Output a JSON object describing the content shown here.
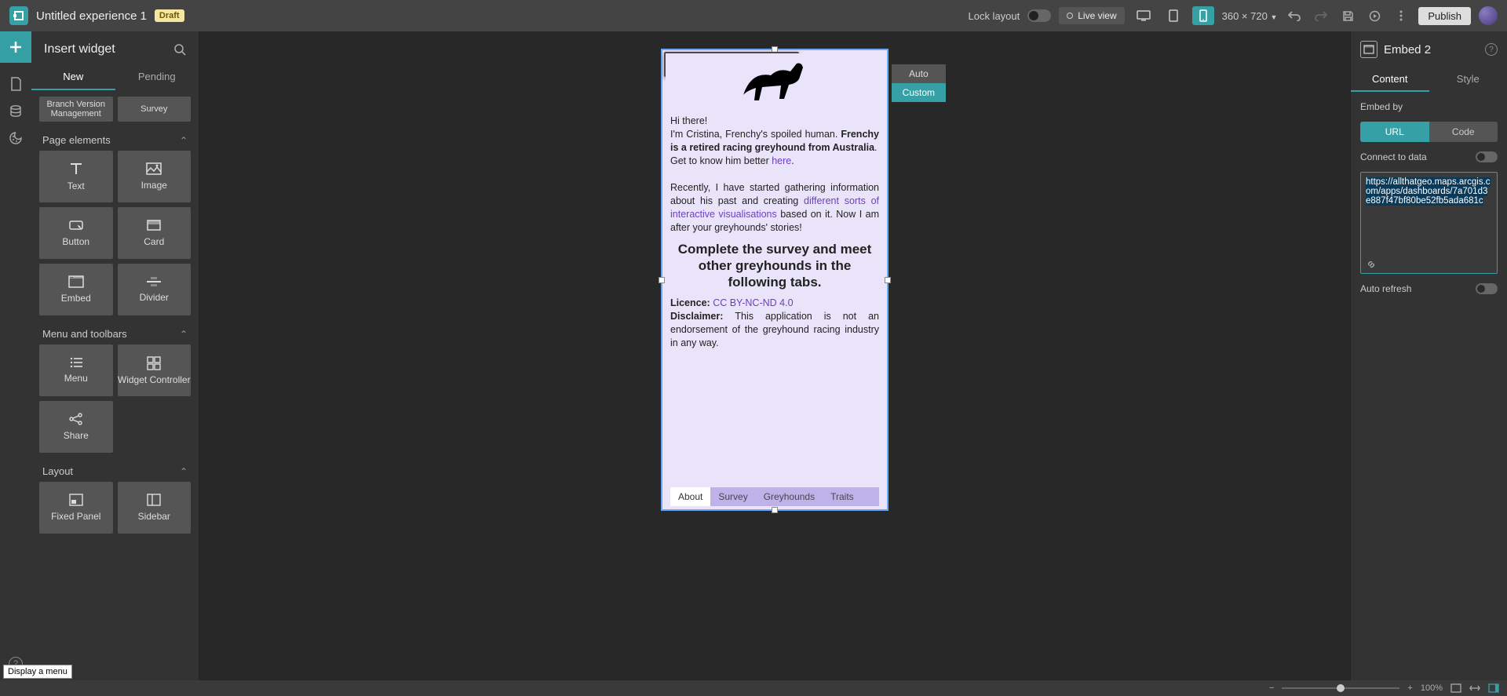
{
  "topbar": {
    "title": "Untitled experience 1",
    "badge": "Draft",
    "lock": "Lock layout",
    "live": "Live view",
    "dimensions": "360 × 720",
    "publish": "Publish"
  },
  "insert": {
    "title": "Insert widget",
    "tabs": {
      "new": "New",
      "pending": "Pending"
    },
    "partial1": "Branch Version Management",
    "partial2": "Survey",
    "sections": {
      "page_elements": "Page elements",
      "menu_toolbars": "Menu and toolbars",
      "layout": "Layout"
    },
    "tiles": {
      "text": "Text",
      "image": "Image",
      "button": "Button",
      "card": "Card",
      "embed": "Embed",
      "divider": "Divider",
      "menu": "Menu",
      "widget_controller": "Widget Controller",
      "share": "Share",
      "fixed_panel": "Fixed Panel",
      "sidebar": "Sidebar"
    }
  },
  "canvas": {
    "sizing": {
      "auto": "Auto",
      "custom": "Custom"
    },
    "tabs": {
      "about": "About",
      "survey": "Survey",
      "greyhounds": "Greyhounds",
      "traits": "Traits"
    },
    "text": {
      "hi": "Hi there!",
      "intro_a": "I'm Cristina, Frenchy's spoiled human. ",
      "intro_b": "Frenchy is a retired racing greyhound from Australia",
      "intro_c": ".",
      "know_a": "Get to know him better ",
      "know_link": "here",
      "know_b": ".",
      "recent_a": "Recently, I have started gathering information about his past and creating ",
      "recent_link": "different sorts of interactive visualisations",
      "recent_b": " based on it. Now I am after your greyhounds' stories!",
      "cta": "Complete the survey and meet other greyhounds in the following tabs.",
      "licence_label": "Licence: ",
      "licence_link": "CC BY-NC-ND 4.0",
      "disclaimer_label": "Disclaimer: ",
      "disclaimer_text": "This application is not an endorsement of the greyhound racing industry in any way."
    }
  },
  "right": {
    "title": "Embed 2",
    "tabs": {
      "content": "Content",
      "style": "Style"
    },
    "embed_by": "Embed by",
    "seg": {
      "url": "URL",
      "code": "Code"
    },
    "connect": "Connect to data",
    "url": "https://allthatgeo.maps.arcgis.com/apps/dashboards/7a701d3e887f47bf80be52fb5ada681c",
    "autorefresh": "Auto refresh"
  },
  "status": {
    "zoom": "100%"
  },
  "tooltip": "Display a menu"
}
